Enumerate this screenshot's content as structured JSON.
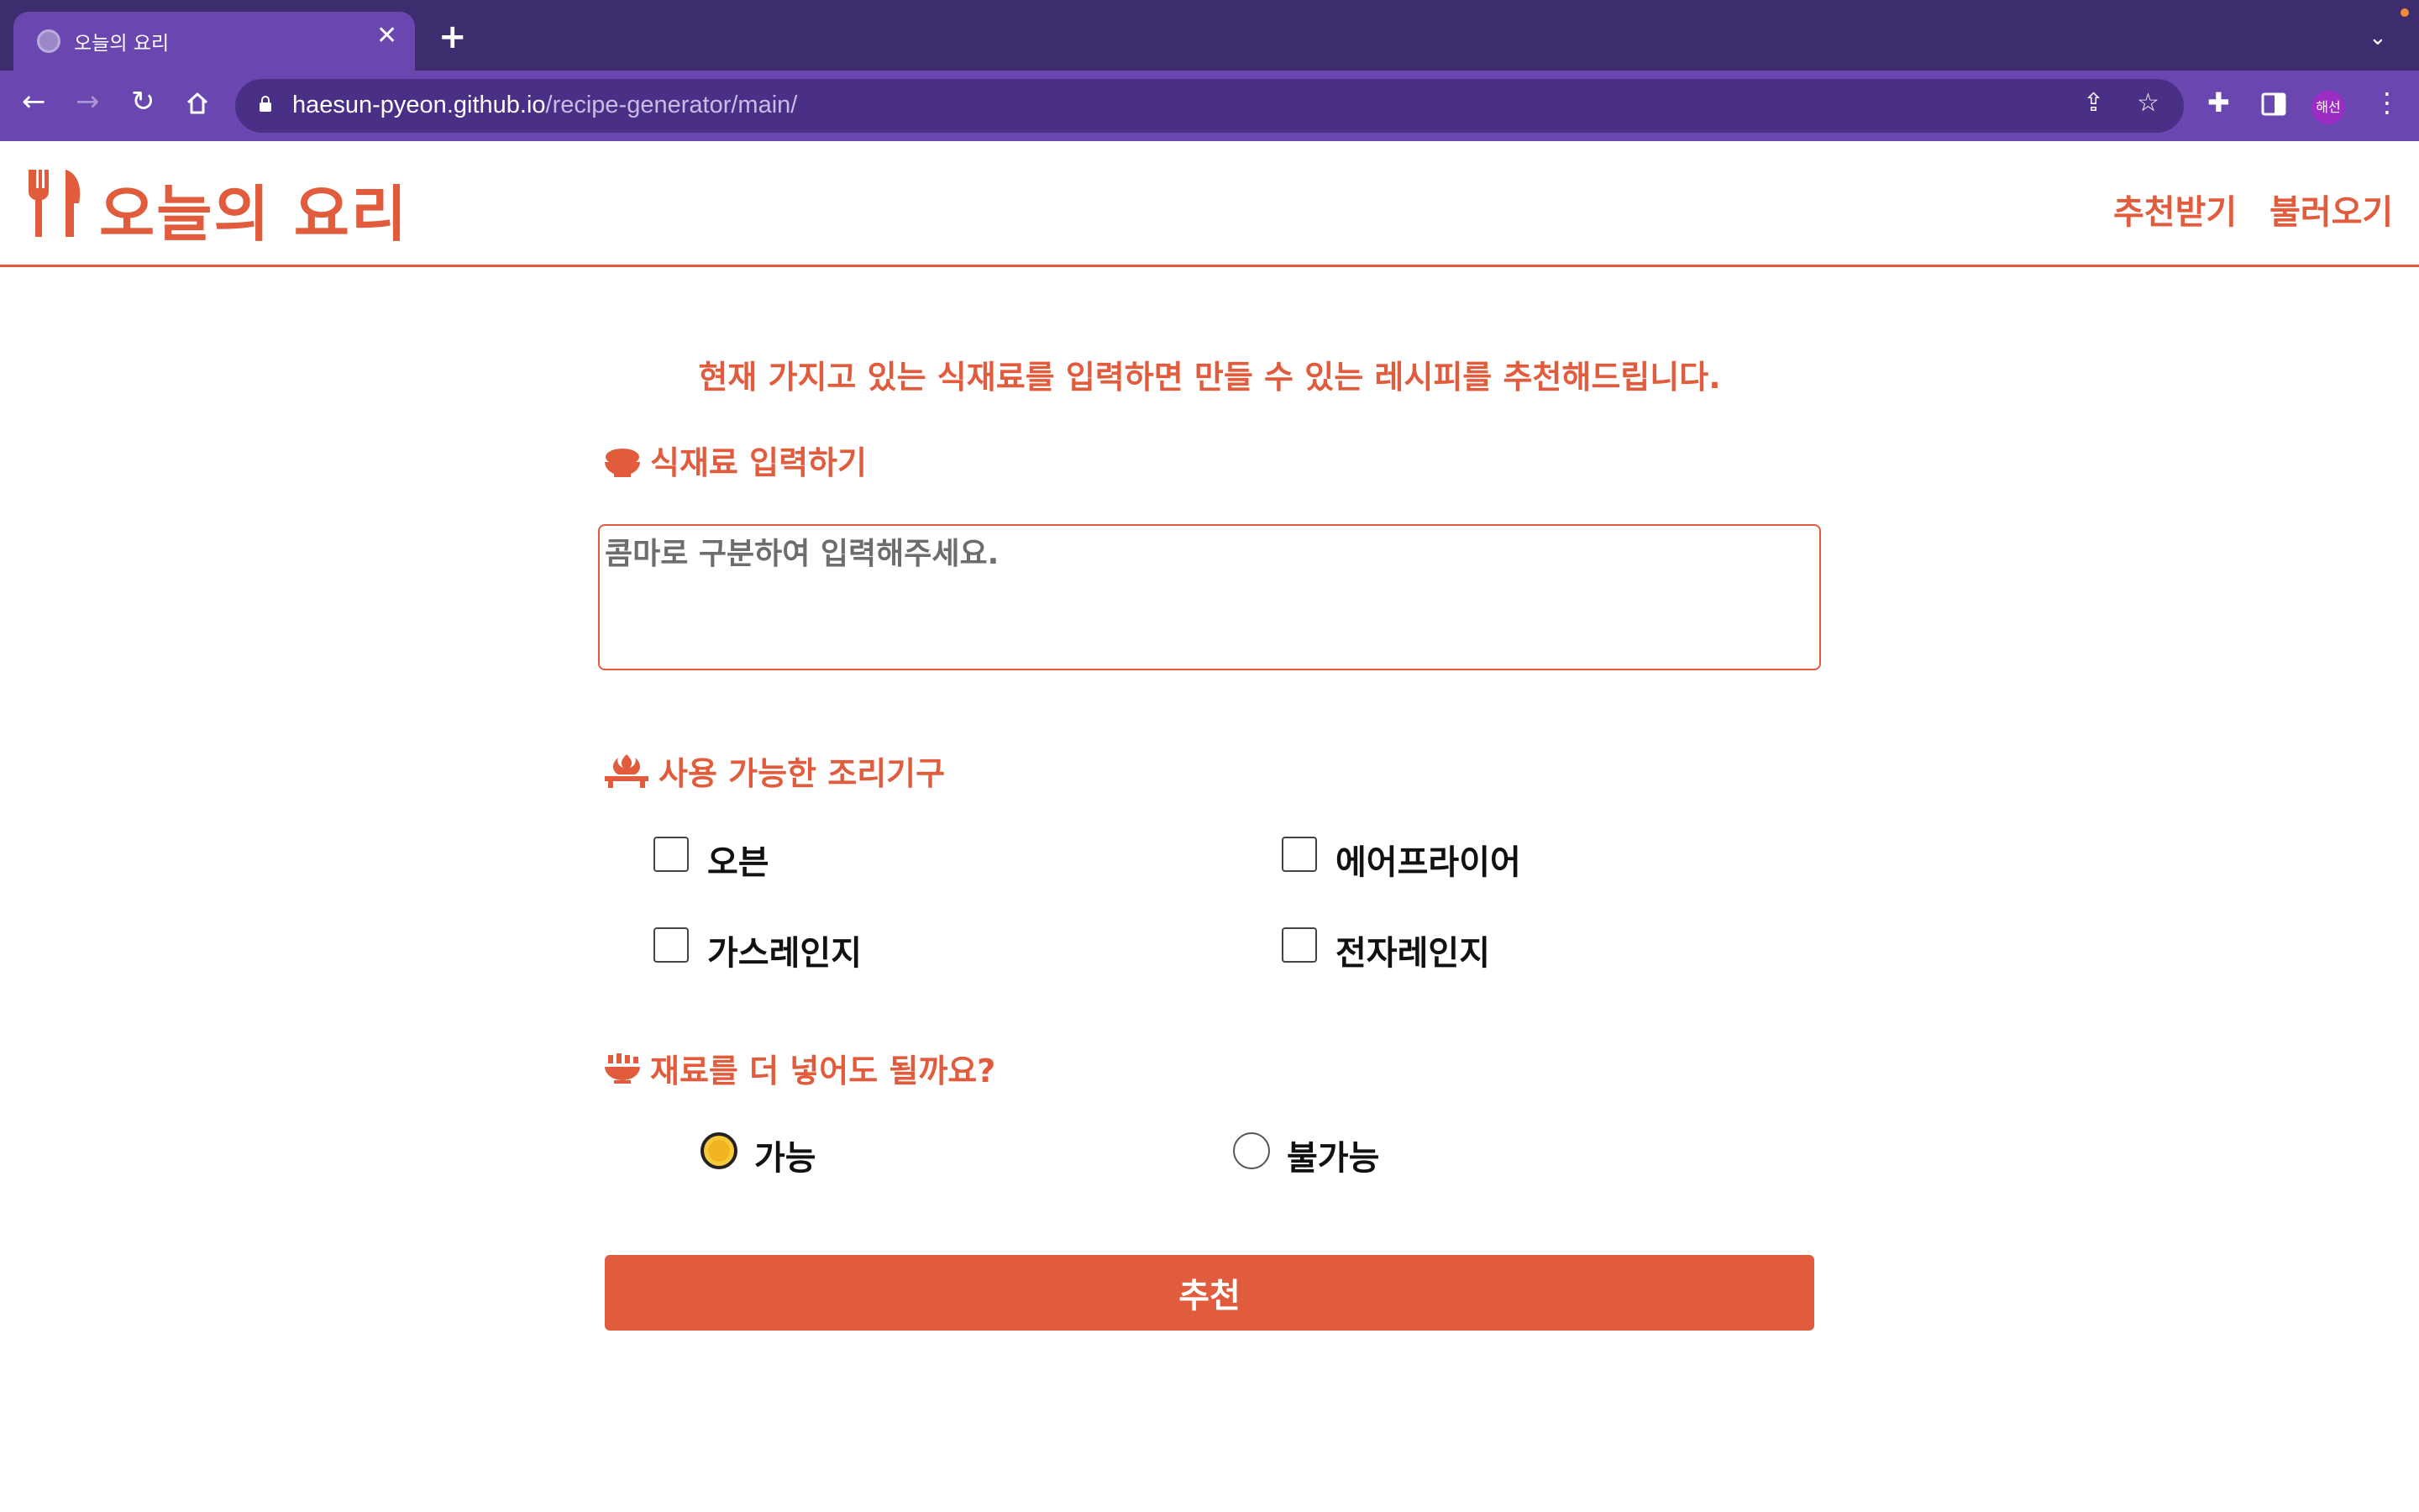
{
  "browser": {
    "tab_title": "오늘의 요리",
    "url_host": "haesun-pyeon.github.io",
    "url_path": "/recipe-generator/main/",
    "profile_label": "해선"
  },
  "header": {
    "logo_text": "오늘의 요리",
    "nav": [
      "추천받기",
      "불러오기"
    ]
  },
  "intro_text": "현재 가지고 있는 식재료를 입력하면 만들 수 있는 레시피를 추천해드립니다.",
  "ingredients": {
    "title": "식재료 입력하기",
    "placeholder": "콤마로 구분하여 입력해주세요."
  },
  "tools": {
    "title": "사용 가능한 조리기구",
    "options": [
      "오븐",
      "에어프라이어",
      "가스레인지",
      "전자레인지"
    ]
  },
  "extra": {
    "title": "재료를 더 넣어도 될까요?",
    "options": [
      "가능",
      "불가능"
    ],
    "selected": "가능"
  },
  "submit_label": "추천",
  "colors": {
    "accent": "#e05c3d",
    "browser_tabbar": "#3d2d6e",
    "browser_toolbar": "#6a46b0"
  }
}
